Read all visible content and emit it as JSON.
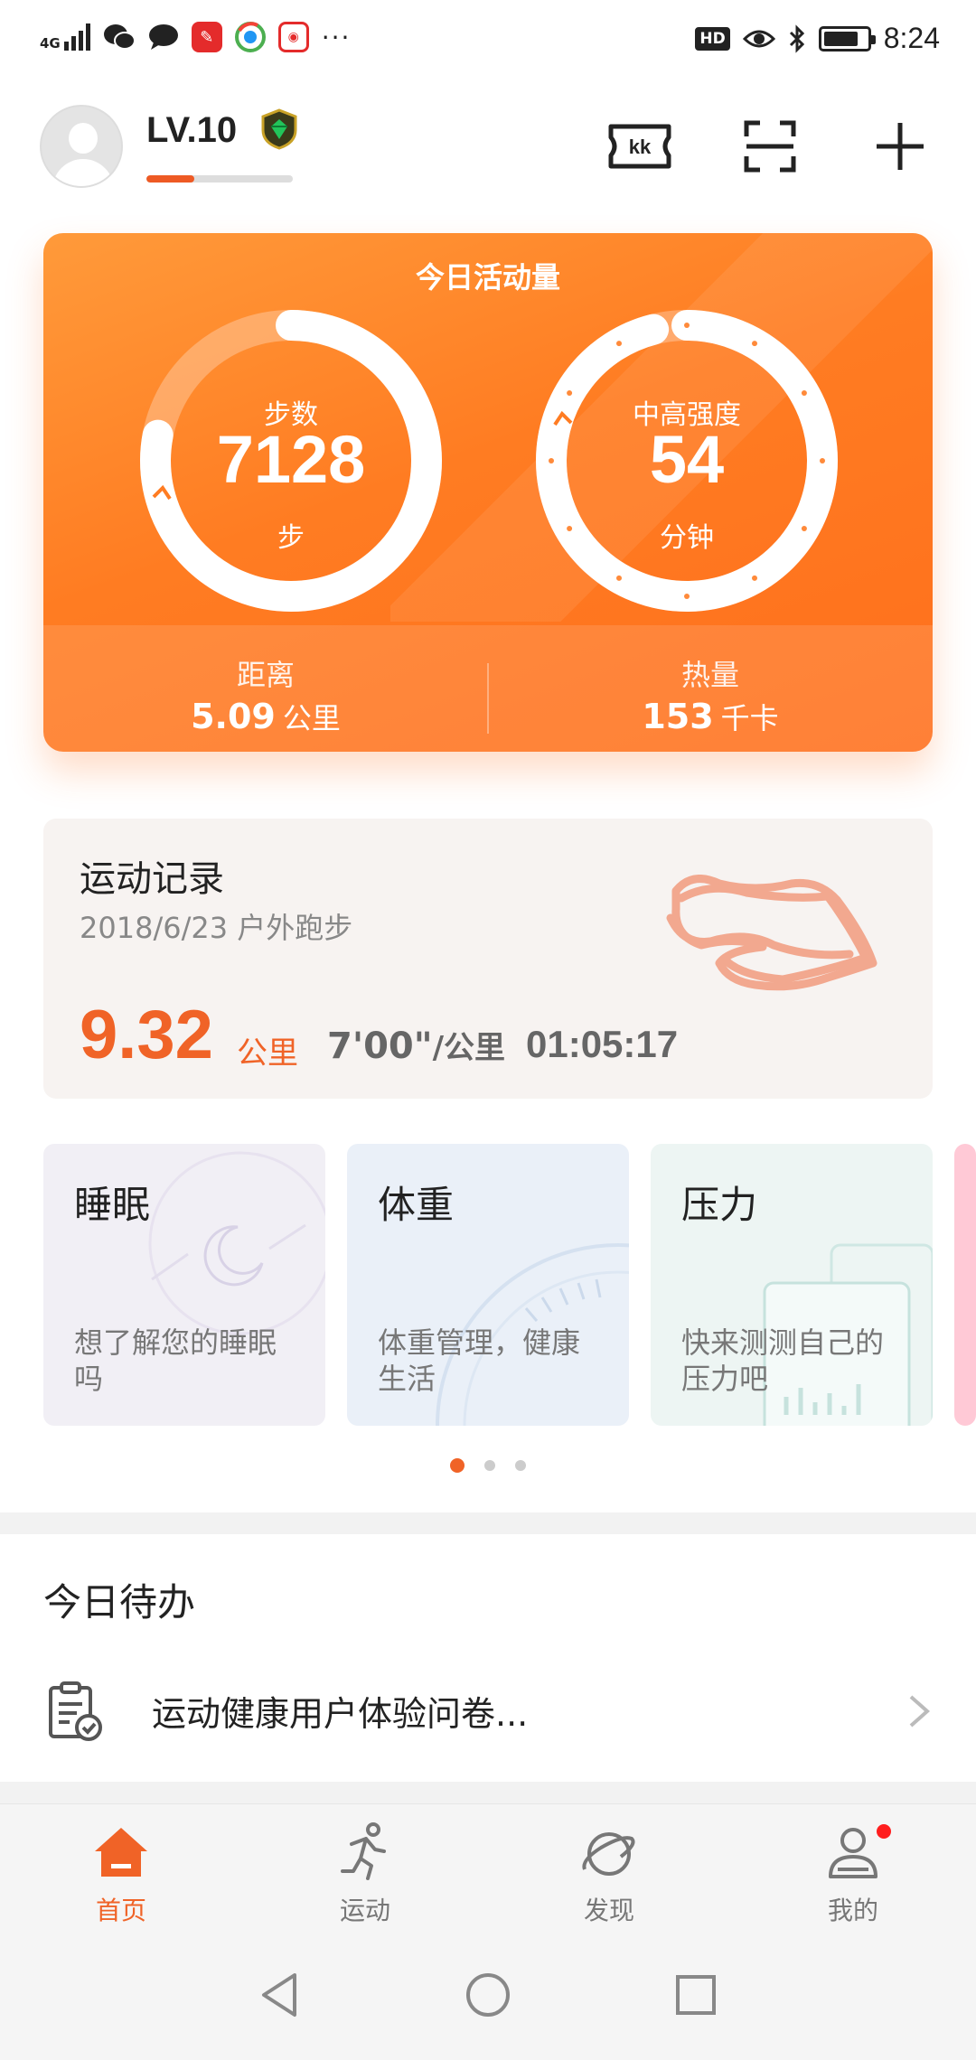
{
  "status": {
    "network": "4G",
    "time": "8:24",
    "hd": "HD",
    "overflow": "···"
  },
  "header": {
    "level": "LV.10",
    "level_progress": 0.33,
    "icons": [
      "ticket-icon",
      "scan-icon",
      "plus-icon"
    ]
  },
  "activity": {
    "title": "今日活动量",
    "steps": {
      "label": "步数",
      "value": "7128",
      "unit": "步",
      "progress": 0.78
    },
    "intensity": {
      "label": "中高强度",
      "value": "54",
      "unit": "分钟",
      "progress": 0.96
    },
    "distance": {
      "label": "距离",
      "value": "5.09",
      "unit": "公里"
    },
    "calories": {
      "label": "热量",
      "value": "153",
      "unit": "千卡"
    }
  },
  "record": {
    "title": "运动记录",
    "subtitle": "2018/6/23  户外跑步",
    "distance": "9.32",
    "distance_unit": "公里",
    "pace": "7'00\"",
    "pace_unit": "/公里",
    "duration": "01:05:17"
  },
  "cards": [
    {
      "title": "睡眠",
      "desc": "想了解您的睡眠吗"
    },
    {
      "title": "体重",
      "desc": "体重管理，健康生活"
    },
    {
      "title": "压力",
      "desc": "快来测测自己的压力吧"
    }
  ],
  "pager": {
    "count": 3,
    "active": 0
  },
  "todo": {
    "title": "今日待办",
    "items": [
      {
        "label": "运动健康用户体验问卷..."
      }
    ]
  },
  "nav": {
    "items": [
      {
        "label": "首页",
        "icon": "home-icon",
        "active": true
      },
      {
        "label": "运动",
        "icon": "run-icon",
        "active": false
      },
      {
        "label": "发现",
        "icon": "planet-icon",
        "active": false
      },
      {
        "label": "我的",
        "icon": "profile-icon",
        "active": false,
        "badge": true
      }
    ]
  },
  "colors": {
    "accent": "#f06327",
    "activity_start": "#ff9a3a",
    "activity_end": "#ff6f1c",
    "record_bg": "#f7f3f1"
  }
}
